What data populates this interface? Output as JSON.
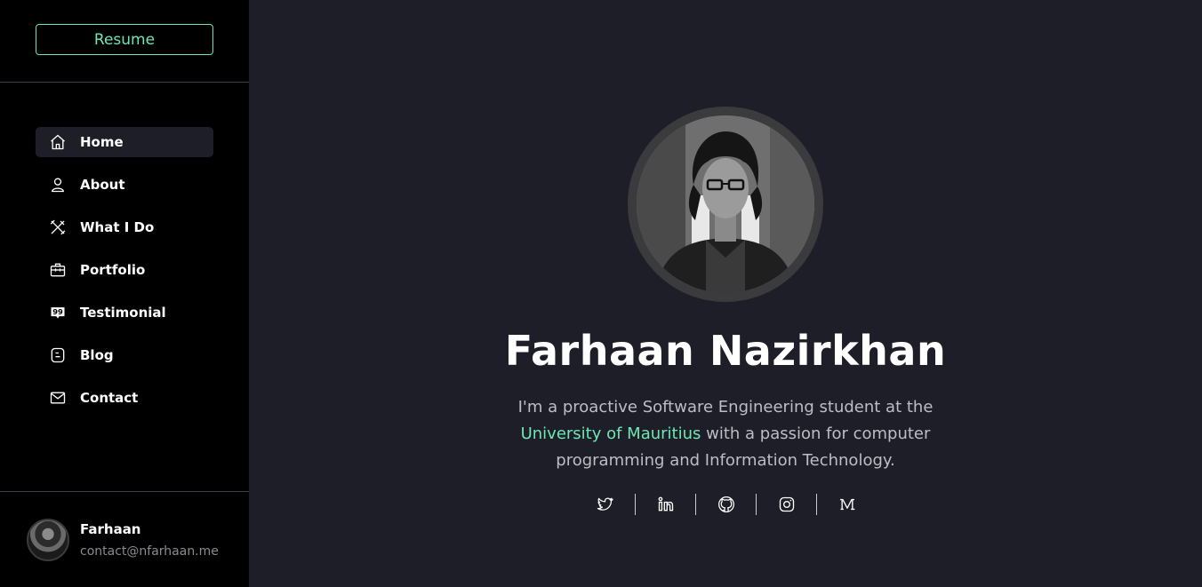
{
  "sidebar": {
    "resume_label": "Resume",
    "nav": [
      {
        "label": "Home",
        "icon": "home-icon",
        "active": true
      },
      {
        "label": "About",
        "icon": "user-icon",
        "active": false
      },
      {
        "label": "What I Do",
        "icon": "tools-icon",
        "active": false
      },
      {
        "label": "Portfolio",
        "icon": "briefcase-icon",
        "active": false
      },
      {
        "label": "Testimonial",
        "icon": "testimonial-icon",
        "active": false
      },
      {
        "label": "Blog",
        "icon": "blog-icon",
        "active": false
      },
      {
        "label": "Contact",
        "icon": "envelope-icon",
        "active": false
      }
    ],
    "profile": {
      "name": "Farhaan",
      "email": "contact@nfarhaan.me"
    }
  },
  "hero": {
    "name": "Farhaan Nazirkhan",
    "bio_pre": "I'm a proactive Software Engineering student at the ",
    "bio_highlight": "University of Mauritius",
    "bio_post": " with a passion for computer programming and Information Technology.",
    "socials": [
      "twitter-icon",
      "linkedin-icon",
      "github-icon",
      "instagram-icon",
      "medium-icon"
    ]
  },
  "colors": {
    "accent": "#6fe7b5",
    "sidebar_bg": "#000000",
    "main_bg": "#1e1e28"
  }
}
